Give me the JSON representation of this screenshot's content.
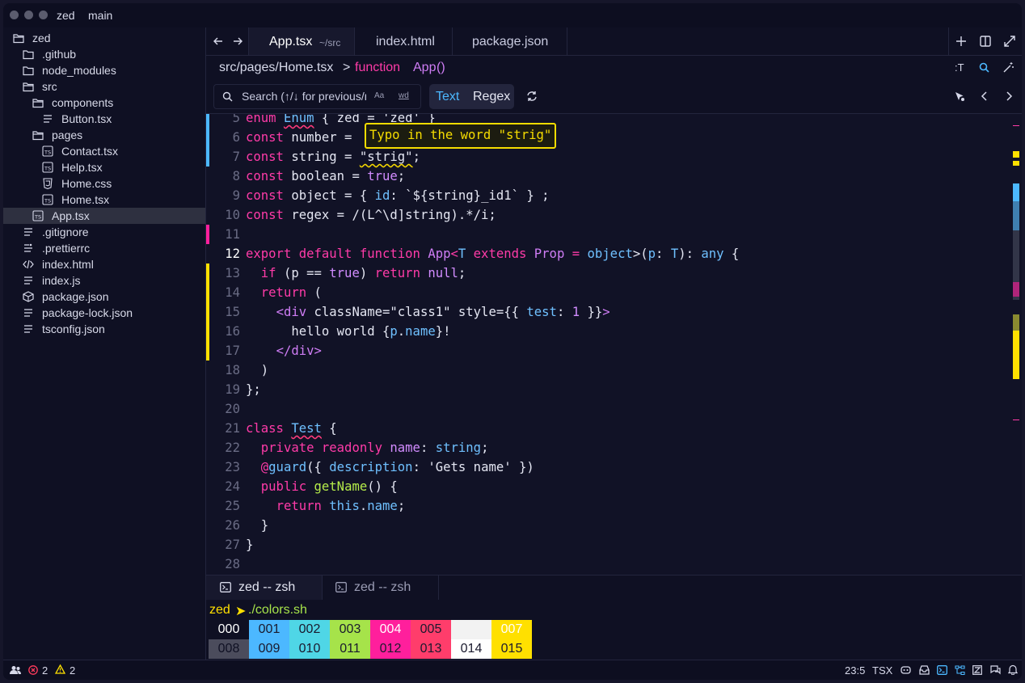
{
  "titlebar": {
    "app": "zed",
    "branch": "main"
  },
  "sidebar": {
    "items": [
      {
        "label": "zed",
        "icon": "folder-open-icon",
        "indent": 0
      },
      {
        "label": ".github",
        "icon": "folder-icon",
        "indent": 1
      },
      {
        "label": "node_modules",
        "icon": "folder-icon",
        "indent": 1
      },
      {
        "label": "src",
        "icon": "folder-open-icon",
        "indent": 1
      },
      {
        "label": "components",
        "icon": "folder-open-icon",
        "indent": 2
      },
      {
        "label": "Button.tsx",
        "icon": "file-icon",
        "indent": 3
      },
      {
        "label": "pages",
        "icon": "folder-open-icon",
        "indent": 2
      },
      {
        "label": "Contact.tsx",
        "icon": "ts-file-icon",
        "indent": 3
      },
      {
        "label": "Help.tsx",
        "icon": "ts-file-icon",
        "indent": 3
      },
      {
        "label": "Home.css",
        "icon": "css-file-icon",
        "indent": 3
      },
      {
        "label": "Home.tsx",
        "icon": "ts-file-icon",
        "indent": 3
      },
      {
        "label": "App.tsx",
        "icon": "ts-file-icon",
        "indent": 2,
        "selected": true
      },
      {
        "label": ".gitignore",
        "icon": "file-icon",
        "indent": 1
      },
      {
        "label": ".prettierrc",
        "icon": "settings-file-icon",
        "indent": 1
      },
      {
        "label": "index.html",
        "icon": "code-icon",
        "indent": 1
      },
      {
        "label": "index.js",
        "icon": "file-icon",
        "indent": 1
      },
      {
        "label": "package.json",
        "icon": "package-icon",
        "indent": 1
      },
      {
        "label": "package-lock.json",
        "icon": "file-icon",
        "indent": 1
      },
      {
        "label": "tsconfig.json",
        "icon": "file-icon",
        "indent": 1
      }
    ]
  },
  "tabs": [
    {
      "label": "App.tsx",
      "path": "~/src",
      "active": true
    },
    {
      "label": "index.html"
    },
    {
      "label": "package.json"
    }
  ],
  "breadcrumb": {
    "path": "src/pages/Home.tsx",
    "sep": ">",
    "keyword": "function",
    "fn": "App",
    "parens": "()"
  },
  "toolbar": {
    "t_label": ":T"
  },
  "search": {
    "placeholder": "Search (↑/↓ for previous/next query)",
    "case_label": "Aa",
    "word_label": "wd",
    "text_label": "Text",
    "regex_label": "Regex"
  },
  "editor": {
    "tooltip": "Typo in the word \"strig\"",
    "current_line": "12",
    "lines": [
      {
        "n": "5",
        "html": "<span class='k'>enum</span> <span class='ty wavy'>Enum</span> { zed = 'zed' }"
      },
      {
        "n": "6",
        "html": "<span class='k'>const</span> number = "
      },
      {
        "n": "7",
        "html": "<span class='k'>const</span> string = <span class='wavyY'>\"strig\"</span>;"
      },
      {
        "n": "8",
        "html": "<span class='k'>const</span> boolean = <span class='pu'>true</span>;"
      },
      {
        "n": "9",
        "html": "<span class='k'>const</span> object = { <span class='ty'>id</span>: `${string}_id1` } ;"
      },
      {
        "n": "10",
        "html": "<span class='k'>const</span> regex = /(L^\\d]string).*/i;"
      },
      {
        "n": "11",
        "html": ""
      },
      {
        "n": "12",
        "html": "<span class='k'>export default function</span> <span class='f'>App</span><span class='k'>&lt;</span><span class='ty'>T</span> <span class='k'>extends</span> <span class='f'>Prop</span> <span class='k'>=</span> <span class='ty'>object</span>&gt;(<span class='ty'>p</span>: <span class='ty'>T</span>): <span class='ty'>any</span> {"
      },
      {
        "n": "13",
        "html": "  <span class='k'>if</span> (p == <span class='pu'>true</span>) <span class='k'>return</span> <span class='pu'>null</span>;"
      },
      {
        "n": "14",
        "html": "  <span class='k'>return</span> ("
      },
      {
        "n": "15",
        "html": "    <span class='f'>&lt;div</span> className=\"class1\" style={{ <span class='ty'>test</span>: <span class='num'>1</span> }}<span class='f'>&gt;</span>"
      },
      {
        "n": "16",
        "html": "      hello world {<span class='ty'>p</span>.<span class='ty'>name</span>}!"
      },
      {
        "n": "17",
        "html": "    <span class='f'>&lt;/div&gt;</span>"
      },
      {
        "n": "18",
        "html": "  )"
      },
      {
        "n": "19",
        "html": "};"
      },
      {
        "n": "20",
        "html": ""
      },
      {
        "n": "21",
        "html": "<span class='k'>class</span> <span class='ty wavy'>Test</span> {"
      },
      {
        "n": "22",
        "html": "  <span class='k'>private readonly</span> <span class='pu'>name</span>: <span class='ty'>string</span>;"
      },
      {
        "n": "23",
        "html": "  <span class='k'>@</span><span class='ty'>guard</span>({ <span class='ty'>description</span>: 'Gets name' })"
      },
      {
        "n": "24",
        "html": "  <span class='k'>public</span> <span class='gr'>getName</span>() {"
      },
      {
        "n": "25",
        "html": "    <span class='k'>return</span> <span class='ty'>this</span>.<span class='ty'>name</span>;"
      },
      {
        "n": "26",
        "html": "  }"
      },
      {
        "n": "27",
        "html": "}"
      },
      {
        "n": "28",
        "html": ""
      }
    ]
  },
  "terminal_tabs": [
    {
      "label": "zed -- zsh",
      "active": true
    },
    {
      "label": "zed -- zsh"
    }
  ],
  "terminal": {
    "prompt_dir": "zed",
    "prompt_arrow": "➤",
    "command": "./colors.sh",
    "row1": [
      {
        "t": "000",
        "bg": "#0f1023",
        "fg": "#ffffff"
      },
      {
        "t": "001",
        "bg": "#4cb8ff",
        "fg": "#1a1a2e"
      },
      {
        "t": "002",
        "bg": "#4fd6e6",
        "fg": "#1a1a2e"
      },
      {
        "t": "003",
        "bg": "#a6e34a",
        "fg": "#1a1a2e"
      },
      {
        "t": "004",
        "bg": "#ff1f9c",
        "fg": "#ffffff"
      },
      {
        "t": "005",
        "bg": "#ff3d6b",
        "fg": "#1a1a2e"
      },
      {
        "t": "",
        "bg": "#f2f2f2",
        "fg": "#1a1a2e"
      },
      {
        "t": "007",
        "bg": "#ffe000",
        "fg": "#ffffff"
      }
    ],
    "row2": [
      {
        "t": "008",
        "bg": "#4b4c5c",
        "fg": "#0f1023"
      },
      {
        "t": "009",
        "bg": "#4cb8ff",
        "fg": "#1a1a2e"
      },
      {
        "t": "010",
        "bg": "#4fd6e6",
        "fg": "#1a1a2e"
      },
      {
        "t": "011",
        "bg": "#a6e34a",
        "fg": "#1a1a2e"
      },
      {
        "t": "012",
        "bg": "#ff1f9c",
        "fg": "#1a1a2e"
      },
      {
        "t": "013",
        "bg": "#ff3d6b",
        "fg": "#1a1a2e"
      },
      {
        "t": "014",
        "bg": "#ffffff",
        "fg": "#1a1a2e"
      },
      {
        "t": "015",
        "bg": "#ffe000",
        "fg": "#1a1a2e"
      }
    ]
  },
  "statusbar": {
    "errors": "2",
    "warnings": "2",
    "cursor": "23:5",
    "language": "TSX"
  },
  "colors": {
    "accent": "#ff3ba8",
    "yellow": "#f6dc00",
    "blue": "#4cb8ff"
  }
}
